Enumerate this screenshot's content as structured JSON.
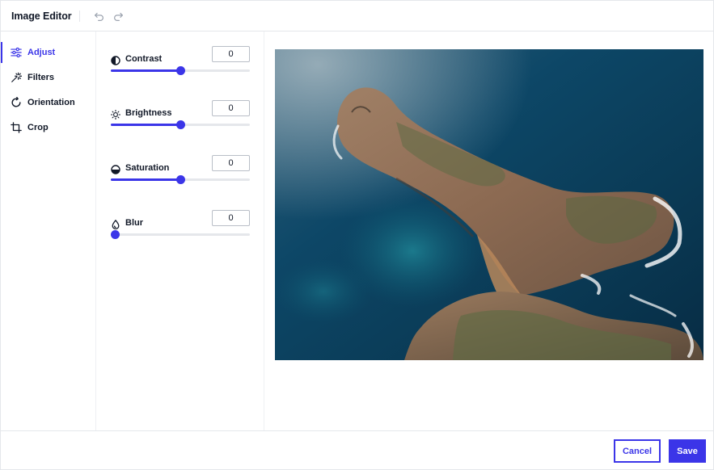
{
  "header": {
    "title": "Image Editor",
    "undo_icon": "undo-icon",
    "redo_icon": "redo-icon"
  },
  "sidebar": {
    "items": [
      {
        "label": "Adjust",
        "icon": "sliders-icon",
        "active": true
      },
      {
        "label": "Filters",
        "icon": "magic-wand-icon",
        "active": false
      },
      {
        "label": "Orientation",
        "icon": "rotate-icon",
        "active": false
      },
      {
        "label": "Crop",
        "icon": "crop-icon",
        "active": false
      }
    ]
  },
  "adjustments": {
    "contrast": {
      "label": "Contrast",
      "value": "0",
      "slider_fraction": 0.5,
      "icon": "contrast-icon"
    },
    "brightness": {
      "label": "Brightness",
      "value": "0",
      "slider_fraction": 0.5,
      "icon": "sun-icon"
    },
    "saturation": {
      "label": "Saturation",
      "value": "0",
      "slider_fraction": 0.5,
      "icon": "saturation-icon"
    },
    "blur": {
      "label": "Blur",
      "value": "0",
      "slider_fraction": 0.0,
      "icon": "droplet-icon"
    }
  },
  "canvas": {
    "image": "aerial-coastline-photo"
  },
  "footer": {
    "cancel_label": "Cancel",
    "save_label": "Save"
  },
  "colors": {
    "accent": "#3b35e8",
    "text": "#111827",
    "border": "#e5e7eb"
  }
}
